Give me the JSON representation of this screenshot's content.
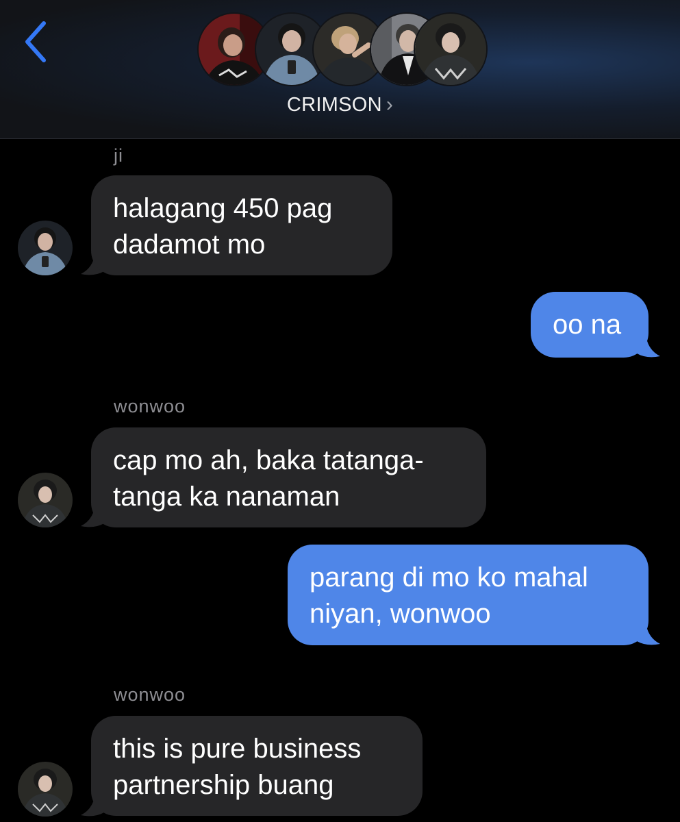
{
  "header": {
    "group_name": "CRIMSON",
    "chevron": "›",
    "back_icon": "chevron-left-icon",
    "accent_color": "#3478f6"
  },
  "messages": [
    {
      "sender": "ji",
      "direction": "incoming",
      "text": "halagang 450 pag\ndadamot mo"
    },
    {
      "direction": "outgoing",
      "text": "oo na"
    },
    {
      "sender": "wonwoo",
      "direction": "incoming",
      "text": "cap mo ah, baka tatanga-\ntanga ka nanaman"
    },
    {
      "direction": "outgoing",
      "text": "parang di mo ko mahal\nniyan, wonwoo"
    },
    {
      "sender": "wonwoo",
      "direction": "incoming",
      "text": "this is pure business\npartnership buang"
    }
  ],
  "colors": {
    "incoming_bubble": "#262628",
    "outgoing_bubble": "#4f86e8",
    "sender_label": "#8e8e93"
  }
}
